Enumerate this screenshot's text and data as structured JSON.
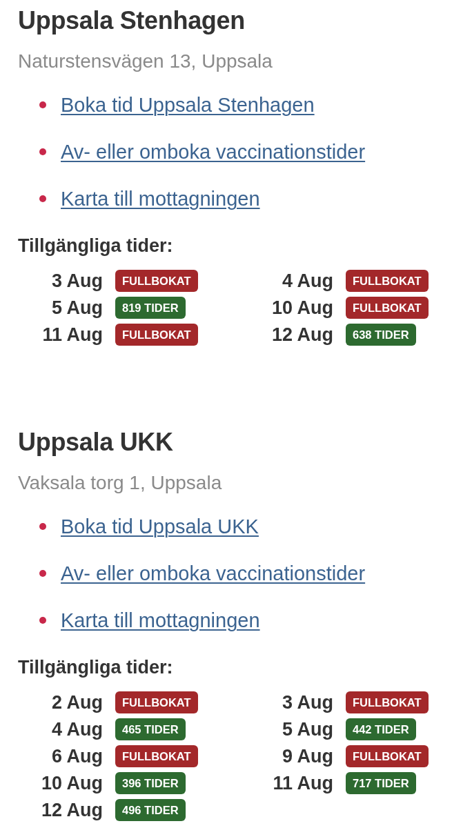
{
  "clinics": [
    {
      "name": "Uppsala Stenhagen",
      "address": "Naturstensvägen 13, Uppsala",
      "links": [
        "Boka tid Uppsala Stenhagen",
        "Av- eller omboka vaccinationstider",
        "Karta till mottagningen"
      ],
      "times_heading": "Tillgängliga tider:",
      "days": [
        {
          "date": "3 Aug",
          "badge": "FULLBOKAT",
          "kind": "full"
        },
        {
          "date": "4 Aug",
          "badge": "FULLBOKAT",
          "kind": "full"
        },
        {
          "date": "5 Aug",
          "badge": "819 TIDER",
          "kind": "open"
        },
        {
          "date": "10 Aug",
          "badge": "FULLBOKAT",
          "kind": "full"
        },
        {
          "date": "11 Aug",
          "badge": "FULLBOKAT",
          "kind": "full"
        },
        {
          "date": "12 Aug",
          "badge": "638 TIDER",
          "kind": "open"
        }
      ]
    },
    {
      "name": "Uppsala UKK",
      "address": "Vaksala torg 1, Uppsala",
      "links": [
        "Boka tid Uppsala UKK",
        "Av- eller omboka vaccinationstider",
        "Karta till mottagningen"
      ],
      "times_heading": "Tillgängliga tider:",
      "days": [
        {
          "date": "2 Aug",
          "badge": "FULLBOKAT",
          "kind": "full"
        },
        {
          "date": "3 Aug",
          "badge": "FULLBOKAT",
          "kind": "full"
        },
        {
          "date": "4 Aug",
          "badge": "465 TIDER",
          "kind": "open"
        },
        {
          "date": "5 Aug",
          "badge": "442 TIDER",
          "kind": "open"
        },
        {
          "date": "6 Aug",
          "badge": "FULLBOKAT",
          "kind": "full"
        },
        {
          "date": "9 Aug",
          "badge": "FULLBOKAT",
          "kind": "full"
        },
        {
          "date": "10 Aug",
          "badge": "396 TIDER",
          "kind": "open"
        },
        {
          "date": "11 Aug",
          "badge": "717 TIDER",
          "kind": "open"
        },
        {
          "date": "12 Aug",
          "badge": "496 TIDER",
          "kind": "open"
        }
      ]
    }
  ]
}
